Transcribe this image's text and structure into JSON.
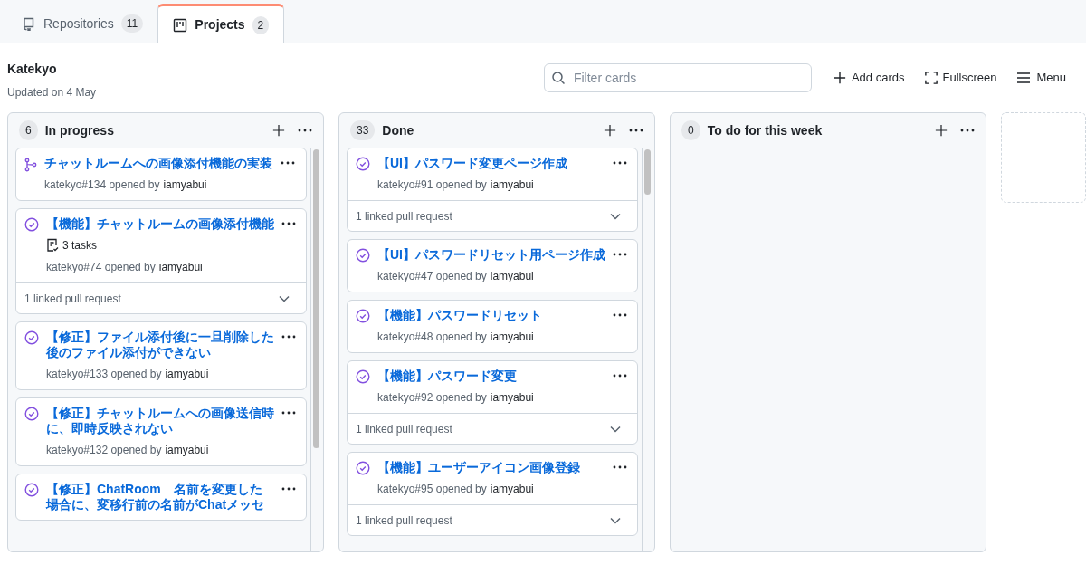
{
  "tabs": [
    {
      "label": "Repositories",
      "count": "11",
      "kind": "repo",
      "selected": false
    },
    {
      "label": "Projects",
      "count": "2",
      "kind": "project",
      "selected": true
    }
  ],
  "project": {
    "title": "Katekyo",
    "updated": "Updated on 4 May"
  },
  "toolbar": {
    "search": {
      "placeholder": "Filter cards"
    },
    "actions": [
      {
        "kind": "add",
        "label": "Add cards"
      },
      {
        "kind": "fullscreen",
        "label": "Fullscreen"
      },
      {
        "kind": "menu",
        "label": "Menu"
      }
    ]
  },
  "columns": [
    {
      "count": "6",
      "title": "In progress",
      "cards": [
        {
          "kind": "pull_request",
          "title": "チャットルームへの画像添付機能の実装",
          "ref": "katekyo#134 opened by",
          "author": "iamyabui"
        },
        {
          "kind": "closed_issue",
          "title": "【機能】チャットルームの画像添付機能",
          "tasks": "3 tasks",
          "ref": "katekyo#74 opened by",
          "author": "iamyabui",
          "linked": "1 linked pull request"
        },
        {
          "kind": "closed_issue",
          "title": "【修正】ファイル添付後に一旦削除した後のファイル添付ができない",
          "ref": "katekyo#133 opened by",
          "author": "iamyabui"
        },
        {
          "kind": "closed_issue",
          "title": "【修正】チャットルームへの画像送信時に、即時反映されない",
          "ref": "katekyo#132 opened by",
          "author": "iamyabui"
        },
        {
          "kind": "closed_issue",
          "title": "【修正】ChatRoom　名前を変更した場合に、変移行前の名前がChatメッセ"
        }
      ]
    },
    {
      "count": "33",
      "title": "Done",
      "cards": [
        {
          "kind": "closed_issue",
          "title": "【UI】パスワード変更ページ作成",
          "ref": "katekyo#91 opened by",
          "author": "iamyabui",
          "linked": "1 linked pull request"
        },
        {
          "kind": "closed_issue",
          "title": "【UI】パスワードリセット用ページ作成",
          "ref": "katekyo#47 opened by",
          "author": "iamyabui"
        },
        {
          "kind": "closed_issue",
          "title": "【機能】パスワードリセット",
          "ref": "katekyo#48 opened by",
          "author": "iamyabui"
        },
        {
          "kind": "closed_issue",
          "title": "【機能】パスワード変更",
          "ref": "katekyo#92 opened by",
          "author": "iamyabui",
          "linked": "1 linked pull request"
        },
        {
          "kind": "closed_issue",
          "title": "【機能】ユーザーアイコン画像登録",
          "ref": "katekyo#95 opened by",
          "author": "iamyabui",
          "linked": "1 linked pull request"
        }
      ]
    },
    {
      "count": "0",
      "title": "To do for this week"
    }
  ]
}
